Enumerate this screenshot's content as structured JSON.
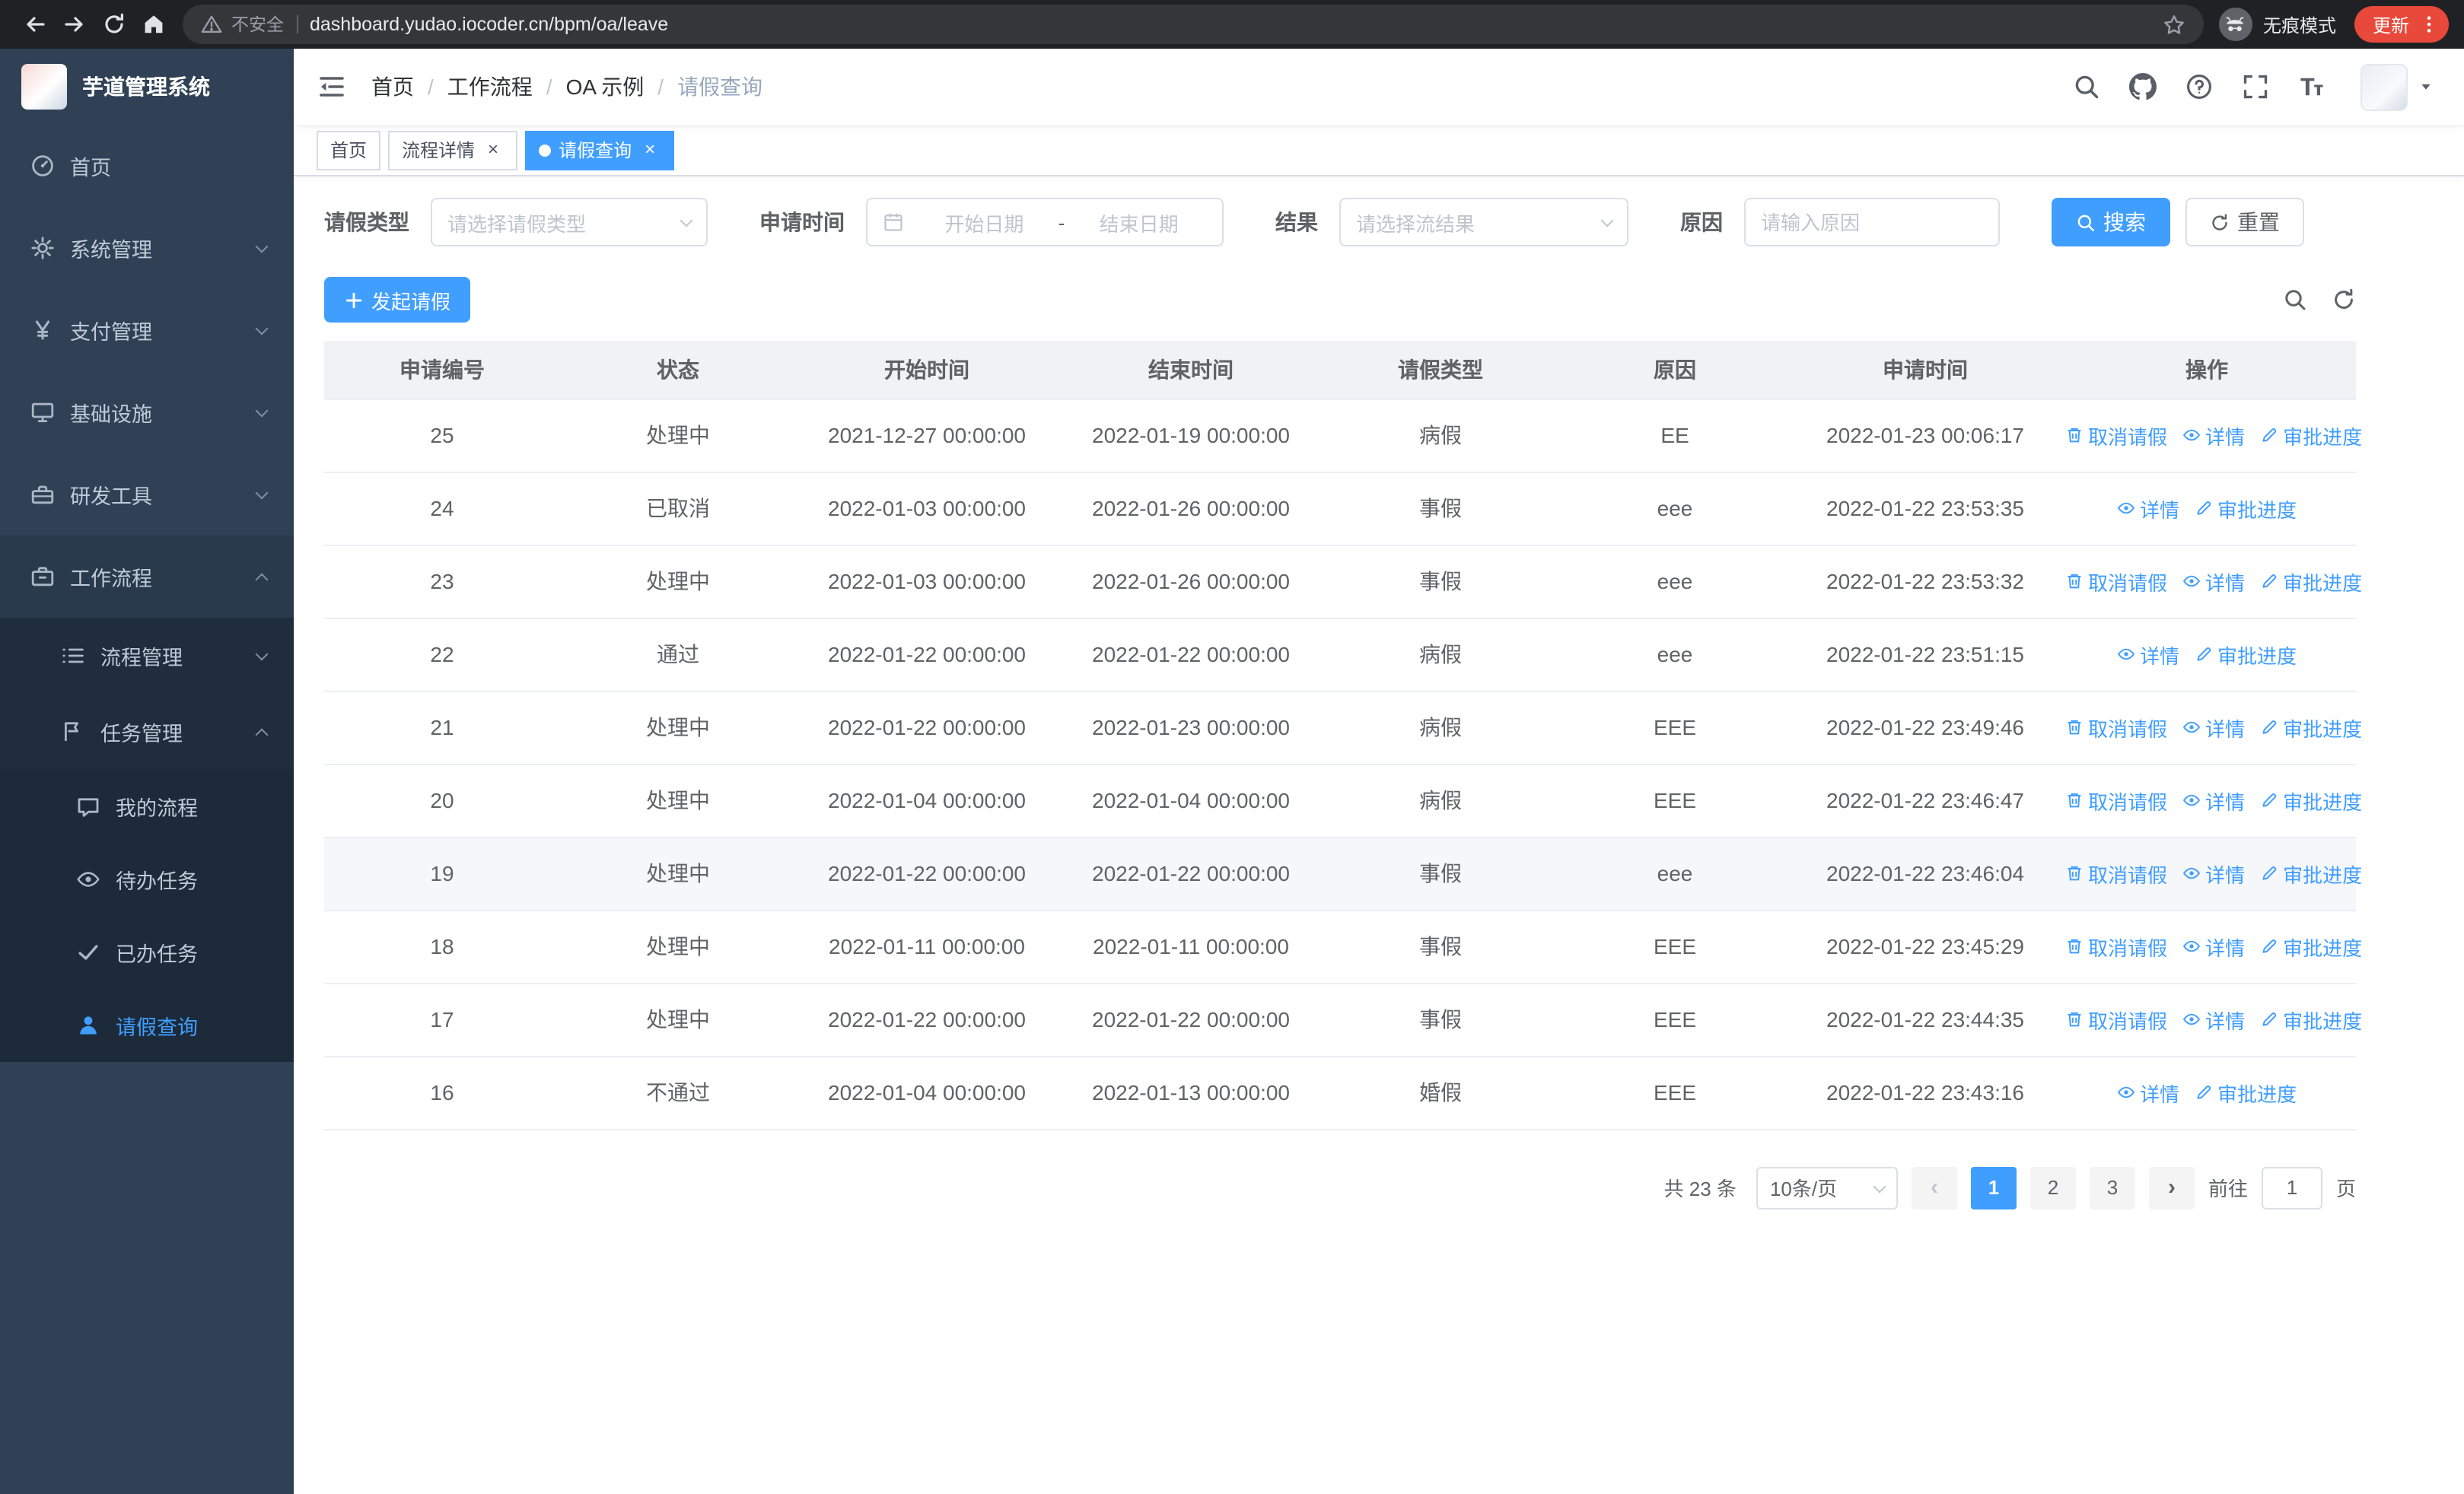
{
  "browser": {
    "security_label": "不安全",
    "url": "dashboard.yudao.iocoder.cn/bpm/oa/leave",
    "incognito_label": "无痕模式",
    "update_label": "更新"
  },
  "sidebar": {
    "logo_title": "芋道管理系统",
    "menu": [
      {
        "key": "home",
        "label": "首页",
        "icon": "dashboard-icon",
        "level": 1,
        "arrow": null,
        "active": false,
        "open": false
      },
      {
        "key": "system-management",
        "label": "系统管理",
        "icon": "gear-icon",
        "level": 1,
        "arrow": "down",
        "active": false,
        "open": false
      },
      {
        "key": "payment-management",
        "label": "支付管理",
        "icon": "yen-icon",
        "level": 1,
        "arrow": "down",
        "active": false,
        "open": false
      },
      {
        "key": "infrastructure",
        "label": "基础设施",
        "icon": "monitor-icon",
        "level": 1,
        "arrow": "down",
        "active": false,
        "open": false
      },
      {
        "key": "dev-tools",
        "label": "研发工具",
        "icon": "toolbox-icon",
        "level": 1,
        "arrow": "down",
        "active": false,
        "open": false
      },
      {
        "key": "workflow",
        "label": "工作流程",
        "icon": "briefcase-icon",
        "level": 1,
        "arrow": "up",
        "active": false,
        "open": true
      },
      {
        "key": "process-management",
        "label": "流程管理",
        "icon": "list-icon",
        "level": 2,
        "arrow": "down",
        "active": false,
        "open": false
      },
      {
        "key": "task-management",
        "label": "任务管理",
        "icon": "flag-icon",
        "level": 2,
        "arrow": "up",
        "active": false,
        "open": true
      },
      {
        "key": "my-process",
        "label": "我的流程",
        "icon": "chat-icon",
        "level": 3,
        "arrow": null,
        "active": false,
        "open": false
      },
      {
        "key": "todo-tasks",
        "label": "待办任务",
        "icon": "eye-icon",
        "level": 3,
        "arrow": null,
        "active": false,
        "open": false
      },
      {
        "key": "done-tasks",
        "label": "已办任务",
        "icon": "check-icon",
        "level": 3,
        "arrow": null,
        "active": false,
        "open": false
      },
      {
        "key": "leave-query",
        "label": "请假查询",
        "icon": "user-icon",
        "level": 3,
        "arrow": null,
        "active": true,
        "open": false
      }
    ]
  },
  "header": {
    "breadcrumb": [
      "首页",
      "工作流程",
      "OA 示例",
      "请假查询"
    ],
    "icons": [
      "search-icon",
      "github-icon",
      "help-icon",
      "fullscreen-icon",
      "font-size-icon"
    ]
  },
  "tabs": [
    {
      "key": "home",
      "label": "首页",
      "closable": false,
      "active": false
    },
    {
      "key": "process-detail",
      "label": "流程详情",
      "closable": true,
      "active": false
    },
    {
      "key": "leave-query",
      "label": "请假查询",
      "closable": true,
      "active": true
    }
  ],
  "filters": {
    "leave_type_label": "请假类型",
    "leave_type_placeholder": "请选择请假类型",
    "apply_time_label": "申请时间",
    "start_date_placeholder": "开始日期",
    "date_separator": "-",
    "end_date_placeholder": "结束日期",
    "result_label": "结果",
    "result_placeholder": "请选择流结果",
    "reason_label": "原因",
    "reason_placeholder": "请输入原因",
    "search_button": "搜索",
    "reset_button": "重置"
  },
  "toolbar": {
    "create_button": "发起请假"
  },
  "table": {
    "columns": [
      "申请编号",
      "状态",
      "开始时间",
      "结束时间",
      "请假类型",
      "原因",
      "申请时间",
      "操作"
    ],
    "action_labels": {
      "cancel": "取消请假",
      "detail": "详情",
      "progress": "审批进度"
    },
    "rows": [
      {
        "id": "25",
        "status": "处理中",
        "start": "2021-12-27 00:00:00",
        "end": "2022-01-19 00:00:00",
        "type": "病假",
        "reason": "EE",
        "apply_time": "2022-01-23 00:06:17",
        "actions": [
          "cancel",
          "detail",
          "progress"
        ],
        "hover": false
      },
      {
        "id": "24",
        "status": "已取消",
        "start": "2022-01-03 00:00:00",
        "end": "2022-01-26 00:00:00",
        "type": "事假",
        "reason": "eee",
        "apply_time": "2022-01-22 23:53:35",
        "actions": [
          "detail",
          "progress"
        ],
        "hover": false
      },
      {
        "id": "23",
        "status": "处理中",
        "start": "2022-01-03 00:00:00",
        "end": "2022-01-26 00:00:00",
        "type": "事假",
        "reason": "eee",
        "apply_time": "2022-01-22 23:53:32",
        "actions": [
          "cancel",
          "detail",
          "progress"
        ],
        "hover": false
      },
      {
        "id": "22",
        "status": "通过",
        "start": "2022-01-22 00:00:00",
        "end": "2022-01-22 00:00:00",
        "type": "病假",
        "reason": "eee",
        "apply_time": "2022-01-22 23:51:15",
        "actions": [
          "detail",
          "progress"
        ],
        "hover": false
      },
      {
        "id": "21",
        "status": "处理中",
        "start": "2022-01-22 00:00:00",
        "end": "2022-01-23 00:00:00",
        "type": "病假",
        "reason": "EEE",
        "apply_time": "2022-01-22 23:49:46",
        "actions": [
          "cancel",
          "detail",
          "progress"
        ],
        "hover": false
      },
      {
        "id": "20",
        "status": "处理中",
        "start": "2022-01-04 00:00:00",
        "end": "2022-01-04 00:00:00",
        "type": "病假",
        "reason": "EEE",
        "apply_time": "2022-01-22 23:46:47",
        "actions": [
          "cancel",
          "detail",
          "progress"
        ],
        "hover": false
      },
      {
        "id": "19",
        "status": "处理中",
        "start": "2022-01-22 00:00:00",
        "end": "2022-01-22 00:00:00",
        "type": "事假",
        "reason": "eee",
        "apply_time": "2022-01-22 23:46:04",
        "actions": [
          "cancel",
          "detail",
          "progress"
        ],
        "hover": true
      },
      {
        "id": "18",
        "status": "处理中",
        "start": "2022-01-11 00:00:00",
        "end": "2022-01-11 00:00:00",
        "type": "事假",
        "reason": "EEE",
        "apply_time": "2022-01-22 23:45:29",
        "actions": [
          "cancel",
          "detail",
          "progress"
        ],
        "hover": false
      },
      {
        "id": "17",
        "status": "处理中",
        "start": "2022-01-22 00:00:00",
        "end": "2022-01-22 00:00:00",
        "type": "事假",
        "reason": "EEE",
        "apply_time": "2022-01-22 23:44:35",
        "actions": [
          "cancel",
          "detail",
          "progress"
        ],
        "hover": false
      },
      {
        "id": "16",
        "status": "不通过",
        "start": "2022-01-04 00:00:00",
        "end": "2022-01-13 00:00:00",
        "type": "婚假",
        "reason": "EEE",
        "apply_time": "2022-01-22 23:43:16",
        "actions": [
          "detail",
          "progress"
        ],
        "hover": false
      }
    ]
  },
  "pagination": {
    "total_text": "共 23 条",
    "page_size": "10条/页",
    "pages": [
      "1",
      "2",
      "3"
    ],
    "active_page": "1",
    "goto_label": "前往",
    "goto_value": "1",
    "page_label": "页"
  },
  "colors": {
    "primary": "#409eff",
    "sidebar_bg": "#304156",
    "sidebar_sub_bg": "#1f2d3d",
    "table_header_bg": "#f0f2f5"
  }
}
